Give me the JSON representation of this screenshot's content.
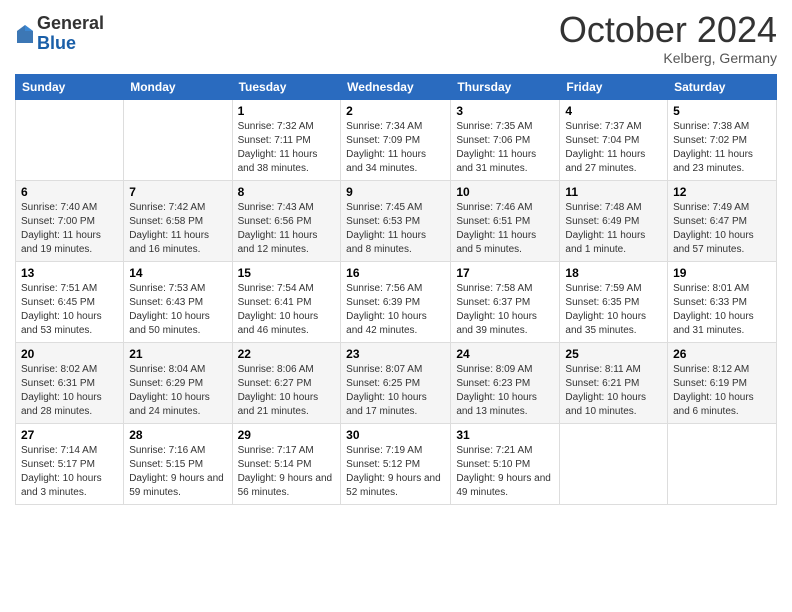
{
  "header": {
    "logo_general": "General",
    "logo_blue": "Blue",
    "month": "October 2024",
    "location": "Kelberg, Germany"
  },
  "weekdays": [
    "Sunday",
    "Monday",
    "Tuesday",
    "Wednesday",
    "Thursday",
    "Friday",
    "Saturday"
  ],
  "weeks": [
    [
      {
        "day": "",
        "sunrise": "",
        "sunset": "",
        "daylight": ""
      },
      {
        "day": "",
        "sunrise": "",
        "sunset": "",
        "daylight": ""
      },
      {
        "day": "1",
        "sunrise": "Sunrise: 7:32 AM",
        "sunset": "Sunset: 7:11 PM",
        "daylight": "Daylight: 11 hours and 38 minutes."
      },
      {
        "day": "2",
        "sunrise": "Sunrise: 7:34 AM",
        "sunset": "Sunset: 7:09 PM",
        "daylight": "Daylight: 11 hours and 34 minutes."
      },
      {
        "day": "3",
        "sunrise": "Sunrise: 7:35 AM",
        "sunset": "Sunset: 7:06 PM",
        "daylight": "Daylight: 11 hours and 31 minutes."
      },
      {
        "day": "4",
        "sunrise": "Sunrise: 7:37 AM",
        "sunset": "Sunset: 7:04 PM",
        "daylight": "Daylight: 11 hours and 27 minutes."
      },
      {
        "day": "5",
        "sunrise": "Sunrise: 7:38 AM",
        "sunset": "Sunset: 7:02 PM",
        "daylight": "Daylight: 11 hours and 23 minutes."
      }
    ],
    [
      {
        "day": "6",
        "sunrise": "Sunrise: 7:40 AM",
        "sunset": "Sunset: 7:00 PM",
        "daylight": "Daylight: 11 hours and 19 minutes."
      },
      {
        "day": "7",
        "sunrise": "Sunrise: 7:42 AM",
        "sunset": "Sunset: 6:58 PM",
        "daylight": "Daylight: 11 hours and 16 minutes."
      },
      {
        "day": "8",
        "sunrise": "Sunrise: 7:43 AM",
        "sunset": "Sunset: 6:56 PM",
        "daylight": "Daylight: 11 hours and 12 minutes."
      },
      {
        "day": "9",
        "sunrise": "Sunrise: 7:45 AM",
        "sunset": "Sunset: 6:53 PM",
        "daylight": "Daylight: 11 hours and 8 minutes."
      },
      {
        "day": "10",
        "sunrise": "Sunrise: 7:46 AM",
        "sunset": "Sunset: 6:51 PM",
        "daylight": "Daylight: 11 hours and 5 minutes."
      },
      {
        "day": "11",
        "sunrise": "Sunrise: 7:48 AM",
        "sunset": "Sunset: 6:49 PM",
        "daylight": "Daylight: 11 hours and 1 minute."
      },
      {
        "day": "12",
        "sunrise": "Sunrise: 7:49 AM",
        "sunset": "Sunset: 6:47 PM",
        "daylight": "Daylight: 10 hours and 57 minutes."
      }
    ],
    [
      {
        "day": "13",
        "sunrise": "Sunrise: 7:51 AM",
        "sunset": "Sunset: 6:45 PM",
        "daylight": "Daylight: 10 hours and 53 minutes."
      },
      {
        "day": "14",
        "sunrise": "Sunrise: 7:53 AM",
        "sunset": "Sunset: 6:43 PM",
        "daylight": "Daylight: 10 hours and 50 minutes."
      },
      {
        "day": "15",
        "sunrise": "Sunrise: 7:54 AM",
        "sunset": "Sunset: 6:41 PM",
        "daylight": "Daylight: 10 hours and 46 minutes."
      },
      {
        "day": "16",
        "sunrise": "Sunrise: 7:56 AM",
        "sunset": "Sunset: 6:39 PM",
        "daylight": "Daylight: 10 hours and 42 minutes."
      },
      {
        "day": "17",
        "sunrise": "Sunrise: 7:58 AM",
        "sunset": "Sunset: 6:37 PM",
        "daylight": "Daylight: 10 hours and 39 minutes."
      },
      {
        "day": "18",
        "sunrise": "Sunrise: 7:59 AM",
        "sunset": "Sunset: 6:35 PM",
        "daylight": "Daylight: 10 hours and 35 minutes."
      },
      {
        "day": "19",
        "sunrise": "Sunrise: 8:01 AM",
        "sunset": "Sunset: 6:33 PM",
        "daylight": "Daylight: 10 hours and 31 minutes."
      }
    ],
    [
      {
        "day": "20",
        "sunrise": "Sunrise: 8:02 AM",
        "sunset": "Sunset: 6:31 PM",
        "daylight": "Daylight: 10 hours and 28 minutes."
      },
      {
        "day": "21",
        "sunrise": "Sunrise: 8:04 AM",
        "sunset": "Sunset: 6:29 PM",
        "daylight": "Daylight: 10 hours and 24 minutes."
      },
      {
        "day": "22",
        "sunrise": "Sunrise: 8:06 AM",
        "sunset": "Sunset: 6:27 PM",
        "daylight": "Daylight: 10 hours and 21 minutes."
      },
      {
        "day": "23",
        "sunrise": "Sunrise: 8:07 AM",
        "sunset": "Sunset: 6:25 PM",
        "daylight": "Daylight: 10 hours and 17 minutes."
      },
      {
        "day": "24",
        "sunrise": "Sunrise: 8:09 AM",
        "sunset": "Sunset: 6:23 PM",
        "daylight": "Daylight: 10 hours and 13 minutes."
      },
      {
        "day": "25",
        "sunrise": "Sunrise: 8:11 AM",
        "sunset": "Sunset: 6:21 PM",
        "daylight": "Daylight: 10 hours and 10 minutes."
      },
      {
        "day": "26",
        "sunrise": "Sunrise: 8:12 AM",
        "sunset": "Sunset: 6:19 PM",
        "daylight": "Daylight: 10 hours and 6 minutes."
      }
    ],
    [
      {
        "day": "27",
        "sunrise": "Sunrise: 7:14 AM",
        "sunset": "Sunset: 5:17 PM",
        "daylight": "Daylight: 10 hours and 3 minutes."
      },
      {
        "day": "28",
        "sunrise": "Sunrise: 7:16 AM",
        "sunset": "Sunset: 5:15 PM",
        "daylight": "Daylight: 9 hours and 59 minutes."
      },
      {
        "day": "29",
        "sunrise": "Sunrise: 7:17 AM",
        "sunset": "Sunset: 5:14 PM",
        "daylight": "Daylight: 9 hours and 56 minutes."
      },
      {
        "day": "30",
        "sunrise": "Sunrise: 7:19 AM",
        "sunset": "Sunset: 5:12 PM",
        "daylight": "Daylight: 9 hours and 52 minutes."
      },
      {
        "day": "31",
        "sunrise": "Sunrise: 7:21 AM",
        "sunset": "Sunset: 5:10 PM",
        "daylight": "Daylight: 9 hours and 49 minutes."
      },
      {
        "day": "",
        "sunrise": "",
        "sunset": "",
        "daylight": ""
      },
      {
        "day": "",
        "sunrise": "",
        "sunset": "",
        "daylight": ""
      }
    ]
  ]
}
